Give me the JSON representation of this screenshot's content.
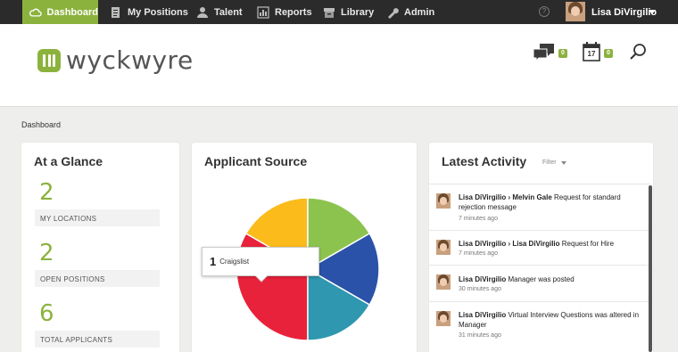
{
  "nav": {
    "items": [
      {
        "label": "Dashboard",
        "icon": "cloud-icon"
      },
      {
        "label": "My Positions",
        "icon": "document-icon"
      },
      {
        "label": "Talent",
        "icon": "person-icon"
      },
      {
        "label": "Reports",
        "icon": "chart-icon"
      },
      {
        "label": "Library",
        "icon": "archive-icon"
      },
      {
        "label": "Admin",
        "icon": "wrench-icon"
      }
    ],
    "user_name": "Lisa DiVirgilio"
  },
  "header": {
    "logo_text": "wyckwyre",
    "messages_count": "0",
    "calendar_day": "17",
    "calendar_count": "0"
  },
  "breadcrumb": "Dashboard",
  "glance": {
    "title": "At a Glance",
    "stats": [
      {
        "value": "2",
        "label": "MY LOCATIONS"
      },
      {
        "value": "2",
        "label": "OPEN POSITIONS"
      },
      {
        "value": "6",
        "label": "TOTAL APPLICANTS"
      }
    ]
  },
  "source": {
    "title": "Applicant Source",
    "tooltip_value": "1",
    "tooltip_label": "Craigslist"
  },
  "chart_data": {
    "type": "pie",
    "title": "Applicant Source",
    "slices": [
      {
        "value": 2,
        "color": "#e8223a"
      },
      {
        "value": 1,
        "color": "#fbbb1b"
      },
      {
        "value": 1,
        "color": "#8cc34f"
      },
      {
        "value": 1,
        "color": "#2a52a8"
      },
      {
        "value": 1,
        "color": "#2f97b0"
      }
    ]
  },
  "activity": {
    "title": "Latest Activity",
    "filter_label": "Filter",
    "items": [
      {
        "actor": "Lisa DiVirgilio",
        "target": "Melvin Gale",
        "text": "Request for standard rejection message",
        "time": "7 minutes ago"
      },
      {
        "actor": "Lisa DiVirgilio",
        "target": "Lisa DiVirgilio",
        "text": "Request for Hire",
        "time": "7 minutes ago"
      },
      {
        "actor": "Lisa DiVirgilio",
        "target": "",
        "text": "Manager was posted",
        "time": "30 minutes ago"
      },
      {
        "actor": "Lisa DiVirgilio",
        "target": "",
        "text": "Virtual Interview Questions was altered in Manager",
        "time": "31 minutes ago"
      }
    ]
  },
  "colors": {
    "accent": "#8cb23e",
    "nav_bg": "#2b2b2b"
  }
}
